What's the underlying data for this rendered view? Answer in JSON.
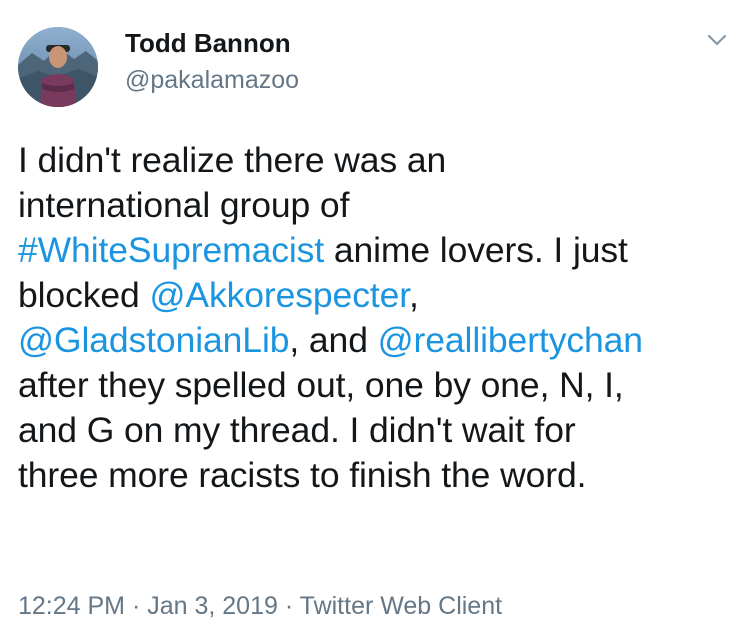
{
  "author": {
    "display_name": "Todd Bannon",
    "handle": "@pakalamazoo",
    "avatar_icon": "profile-photo"
  },
  "menu": {
    "icon": "chevron-down-icon"
  },
  "tweet": {
    "lines": [
      [
        {
          "text": "I didn't realize there was an",
          "type": "text"
        }
      ],
      [
        {
          "text": "international group of",
          "type": "text"
        }
      ],
      [
        {
          "text": "#WhiteSupremacist",
          "type": "hashtag"
        },
        {
          "text": " anime lovers. I just",
          "type": "text"
        }
      ],
      [
        {
          "text": "blocked ",
          "type": "text"
        },
        {
          "text": "@Akkorespecter",
          "type": "mention"
        },
        {
          "text": ",",
          "type": "text"
        }
      ],
      [
        {
          "text": "@GladstonianLib",
          "type": "mention"
        },
        {
          "text": ", and ",
          "type": "text"
        },
        {
          "text": "@reallibertychan",
          "type": "mention"
        }
      ],
      [
        {
          "text": "after they spelled out, one by one, N, I,",
          "type": "text"
        }
      ],
      [
        {
          "text": "and G on my thread. I didn't wait for",
          "type": "text"
        }
      ],
      [
        {
          "text": "three more racists to finish the word.",
          "type": "text"
        }
      ]
    ]
  },
  "meta": {
    "time": "12:24 PM",
    "date": "Jan 3, 2019",
    "source": "Twitter Web Client",
    "separator": " · "
  },
  "colors": {
    "link": "#1b95e0",
    "text": "#14171a",
    "secondary": "#657786"
  }
}
